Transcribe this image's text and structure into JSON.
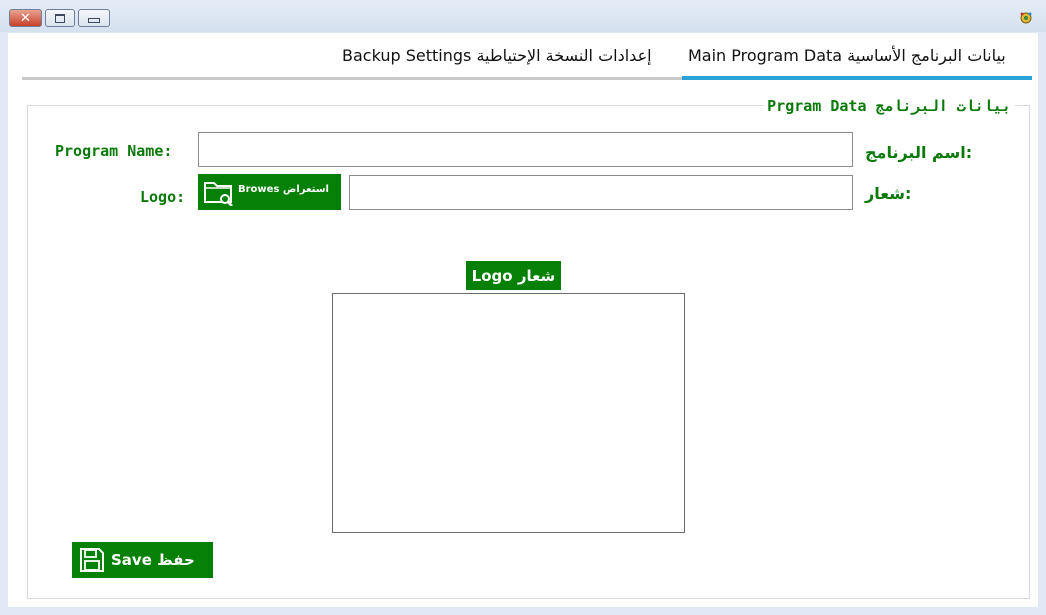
{
  "window": {
    "close_glyph": "✕",
    "icons": {
      "restore": "restore-icon",
      "minimize": "minimize-icon",
      "app": "app-icon"
    }
  },
  "tabs": [
    {
      "label": "Backup Settings إعدادات النسخة الإحتياطية",
      "active": false
    },
    {
      "label": "Main Program Data بيانات البرنامج الأساسية",
      "active": true
    }
  ],
  "group": {
    "title": "Prgram Data بيانات البرنامج"
  },
  "form": {
    "program_name_label_en": "Program Name:",
    "program_name_label_ar": "اسم البرنامج:",
    "program_name_value": "",
    "logo_label_en": "Logo:",
    "logo_label_ar": "شعار:",
    "logo_path_value": "",
    "browse_button": "Browes استعراض"
  },
  "logo_panel": {
    "caption": "Logo شعار"
  },
  "save_button": {
    "label": "Save حفظ"
  },
  "colors": {
    "accent_green": "#078007",
    "label_green": "#0b7a0b",
    "tab_active": "#2ba3d7"
  }
}
